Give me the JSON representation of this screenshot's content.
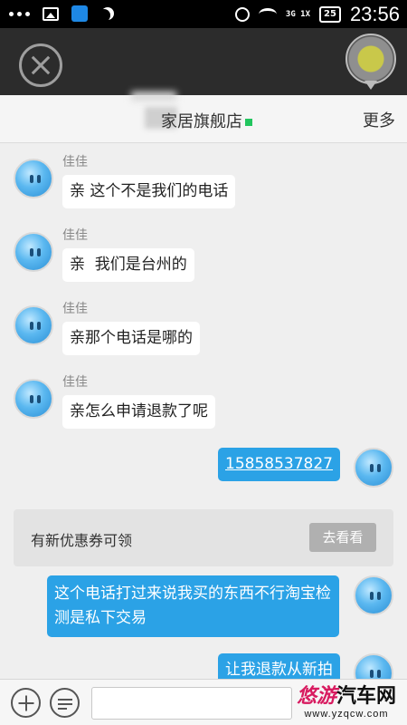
{
  "status_bar": {
    "network": "3G 1X",
    "battery": "25",
    "time": "23:56"
  },
  "title_bar": {
    "shop_name": "家居旗舰店",
    "more_label": "更多"
  },
  "messages": [
    {
      "sender": "佳佳",
      "text": "亲 这个不是我们的电话"
    },
    {
      "sender": "佳佳",
      "text": "亲  我们是台州的"
    },
    {
      "sender": "佳佳",
      "text": "亲那个电话是哪的"
    },
    {
      "sender": "佳佳",
      "text": "亲怎么申请退款了呢"
    }
  ],
  "outgoing": [
    {
      "text": "15858537827",
      "is_link": true
    },
    {
      "text": "这个电话打过来说我买的东西不行淘宝检测是私下交易"
    },
    {
      "text": "让我退款从新拍"
    }
  ],
  "coupon": {
    "text": "有新优惠券可领",
    "button": "去看看"
  },
  "input_bar": {
    "placeholder": ""
  },
  "watermark": {
    "logo_part1": "悠游",
    "logo_part2": "汽车网",
    "url": "www.yzqcw.com"
  },
  "colors": {
    "outgoing_bubble": "#2ba2e6",
    "online_dot": "#22c55e",
    "header_bg": "#2c2c2c"
  }
}
